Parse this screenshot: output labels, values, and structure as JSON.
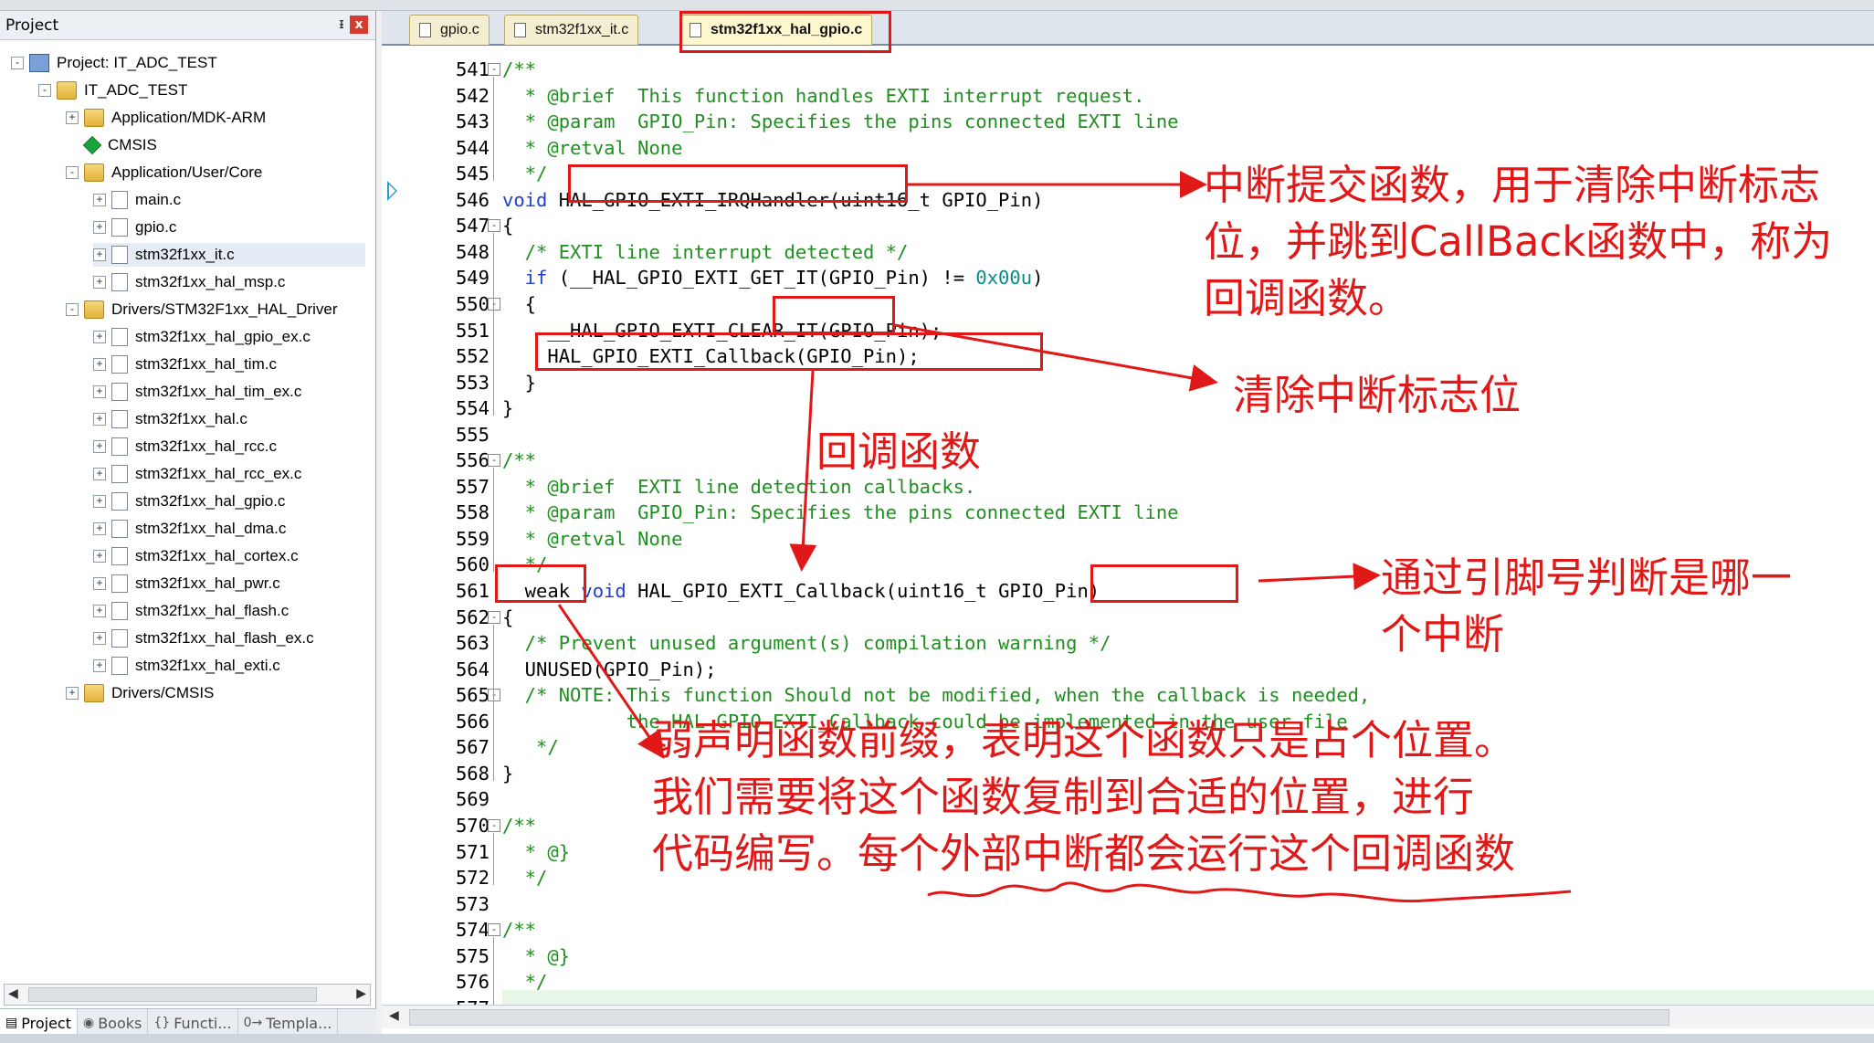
{
  "project_panel": {
    "title": "Project",
    "pin": "ᵻ",
    "close": "x",
    "tree": [
      {
        "label": "Project: IT_ADC_TEST",
        "icon": "project-icon",
        "exp": "-"
      },
      {
        "label": "IT_ADC_TEST",
        "icon": "folder-icon",
        "exp": "-"
      },
      {
        "label": "Application/MDK-ARM",
        "icon": "folder-icon",
        "exp": "+"
      },
      {
        "label": "CMSIS",
        "icon": "cmsis-gem-icon",
        "exp": ""
      },
      {
        "label": "Application/User/Core",
        "icon": "folder-icon",
        "exp": "-"
      },
      {
        "label": "main.c",
        "icon": "file-icon",
        "exp": "+"
      },
      {
        "label": "gpio.c",
        "icon": "file-icon",
        "exp": "+"
      },
      {
        "label": "stm32f1xx_it.c",
        "icon": "file-icon",
        "exp": "+"
      },
      {
        "label": "stm32f1xx_hal_msp.c",
        "icon": "file-icon",
        "exp": "+"
      },
      {
        "label": "Drivers/STM32F1xx_HAL_Driver",
        "icon": "folder-icon",
        "exp": "-"
      },
      {
        "label": "stm32f1xx_hal_gpio_ex.c",
        "icon": "file-icon",
        "exp": "+"
      },
      {
        "label": "stm32f1xx_hal_tim.c",
        "icon": "file-icon",
        "exp": "+"
      },
      {
        "label": "stm32f1xx_hal_tim_ex.c",
        "icon": "file-icon",
        "exp": "+"
      },
      {
        "label": "stm32f1xx_hal.c",
        "icon": "file-icon",
        "exp": "+"
      },
      {
        "label": "stm32f1xx_hal_rcc.c",
        "icon": "file-icon",
        "exp": "+"
      },
      {
        "label": "stm32f1xx_hal_rcc_ex.c",
        "icon": "file-icon",
        "exp": "+"
      },
      {
        "label": "stm32f1xx_hal_gpio.c",
        "icon": "file-icon",
        "exp": "+"
      },
      {
        "label": "stm32f1xx_hal_dma.c",
        "icon": "file-icon",
        "exp": "+"
      },
      {
        "label": "stm32f1xx_hal_cortex.c",
        "icon": "file-icon",
        "exp": "+"
      },
      {
        "label": "stm32f1xx_hal_pwr.c",
        "icon": "file-icon",
        "exp": "+"
      },
      {
        "label": "stm32f1xx_hal_flash.c",
        "icon": "file-icon",
        "exp": "+"
      },
      {
        "label": "stm32f1xx_hal_flash_ex.c",
        "icon": "file-icon",
        "exp": "+"
      },
      {
        "label": "stm32f1xx_hal_exti.c",
        "icon": "file-icon",
        "exp": "+"
      },
      {
        "label": "Drivers/CMSIS",
        "icon": "folder-icon",
        "exp": "+"
      }
    ],
    "bottom_tabs": [
      {
        "label": "Project",
        "icon": "project-tab-icon",
        "glyph": "▤"
      },
      {
        "label": "Books",
        "icon": "books-icon",
        "glyph": "◉"
      },
      {
        "label": "Functi...",
        "icon": "functions-icon",
        "glyph": "{}"
      },
      {
        "label": "Templa...",
        "icon": "templates-icon",
        "glyph": "0→"
      }
    ]
  },
  "editor": {
    "tabs": [
      "gpio.c",
      "stm32f1xx_it.c",
      "stm32f1xx_hal_gpio.c"
    ],
    "active_tab": "stm32f1xx_hal_gpio.c",
    "lines": [
      {
        "n": "541",
        "fold": "-",
        "parts": [
          [
            "cm",
            "/**"
          ]
        ]
      },
      {
        "n": "542",
        "parts": [
          [
            "cm",
            "  * @brief  This function handles EXTI interrupt request."
          ]
        ]
      },
      {
        "n": "543",
        "parts": [
          [
            "cm",
            "  * @param  GPIO_Pin: Specifies the pins connected EXTI line"
          ]
        ]
      },
      {
        "n": "544",
        "parts": [
          [
            "cm",
            "  * @retval None"
          ]
        ]
      },
      {
        "n": "545",
        "parts": [
          [
            "cm",
            "  */"
          ]
        ]
      },
      {
        "n": "546",
        "parts": [
          [
            "kw",
            "void"
          ],
          [
            "",
            " HAL_GPIO_EXTI_IRQHandler(uint16_t GPIO_Pin)"
          ]
        ]
      },
      {
        "n": "547",
        "fold": "-",
        "parts": [
          [
            "",
            "{"
          ]
        ]
      },
      {
        "n": "548",
        "parts": [
          [
            "cm",
            "  /* EXTI line interrupt detected */"
          ]
        ]
      },
      {
        "n": "549",
        "parts": [
          [
            "kw",
            "  if"
          ],
          [
            "",
            " (__HAL_GPIO_EXTI_GET_IT(GPIO_Pin) != "
          ],
          [
            "num",
            "0x00u"
          ],
          [
            "",
            ")"
          ]
        ]
      },
      {
        "n": "550",
        "fold": "-",
        "parts": [
          [
            "",
            "  {"
          ]
        ]
      },
      {
        "n": "551",
        "parts": [
          [
            "",
            "    __HAL_GPIO_EXTI_CLEAR_IT(GPIO_Pin);"
          ]
        ]
      },
      {
        "n": "552",
        "parts": [
          [
            "",
            "    HAL_GPIO_EXTI_Callback(GPIO_Pin);"
          ]
        ]
      },
      {
        "n": "553",
        "parts": [
          [
            "",
            "  }"
          ]
        ]
      },
      {
        "n": "554",
        "parts": [
          [
            "",
            "}"
          ]
        ]
      },
      {
        "n": "555",
        "parts": [
          [
            "",
            ""
          ]
        ]
      },
      {
        "n": "556",
        "fold": "-",
        "parts": [
          [
            "cm",
            "/**"
          ]
        ]
      },
      {
        "n": "557",
        "parts": [
          [
            "cm",
            "  * @brief  EXTI line detection callbacks."
          ]
        ]
      },
      {
        "n": "558",
        "parts": [
          [
            "cm",
            "  * @param  GPIO_Pin: Specifies the pins connected EXTI line"
          ]
        ]
      },
      {
        "n": "559",
        "parts": [
          [
            "cm",
            "  * @retval None"
          ]
        ]
      },
      {
        "n": "560",
        "parts": [
          [
            "cm",
            "  */"
          ]
        ]
      },
      {
        "n": "561",
        "parts": [
          [
            "",
            "__weak "
          ],
          [
            "kw",
            "void"
          ],
          [
            "",
            " HAL_GPIO_EXTI_Callback(uint16_t GPIO_Pin)"
          ]
        ]
      },
      {
        "n": "562",
        "fold": "-",
        "parts": [
          [
            "",
            "{"
          ]
        ]
      },
      {
        "n": "563",
        "parts": [
          [
            "cm",
            "  /* Prevent unused argument(s) compilation warning */"
          ]
        ]
      },
      {
        "n": "564",
        "parts": [
          [
            "",
            "  UNUSED(GPIO_Pin);"
          ]
        ]
      },
      {
        "n": "565",
        "fold": "-",
        "parts": [
          [
            "cm",
            "  /* NOTE: This function Should not be modified, when the callback is needed,"
          ]
        ]
      },
      {
        "n": "566",
        "parts": [
          [
            "cm",
            "           the HAL_GPIO_EXTI_Callback could be implemented in the user file"
          ]
        ]
      },
      {
        "n": "567",
        "parts": [
          [
            "cm",
            "   */"
          ]
        ]
      },
      {
        "n": "568",
        "parts": [
          [
            "",
            "}"
          ]
        ]
      },
      {
        "n": "569",
        "parts": [
          [
            "",
            ""
          ]
        ]
      },
      {
        "n": "570",
        "fold": "-",
        "parts": [
          [
            "cm",
            "/**"
          ]
        ]
      },
      {
        "n": "571",
        "parts": [
          [
            "cm",
            "  * @}"
          ]
        ]
      },
      {
        "n": "572",
        "parts": [
          [
            "cm",
            "  */"
          ]
        ]
      },
      {
        "n": "573",
        "parts": [
          [
            "",
            ""
          ]
        ]
      },
      {
        "n": "574",
        "fold": "-",
        "parts": [
          [
            "cm",
            "/**"
          ]
        ]
      },
      {
        "n": "575",
        "parts": [
          [
            "cm",
            "  * @}"
          ]
        ]
      },
      {
        "n": "576",
        "parts": [
          [
            "cm",
            "  */"
          ]
        ]
      },
      {
        "n": "577",
        "parts": [
          [
            "",
            ""
          ]
        ]
      }
    ]
  },
  "annotations": {
    "irq_handler_note": [
      "中断提交函数，用于清除中断标志",
      "位，并跳到CallBack函数中，称为",
      "回调函数。"
    ],
    "clear_flag_note": "清除中断标志位",
    "callback_note": "回调函数",
    "gpio_pin_note": [
      "通过引脚号判断是哪一",
      "个中断"
    ],
    "weak_note": [
      "弱声明函数前缀，表明这个函数只是占个位置。",
      "我们需要将这个函数复制到合适的位置，进行",
      "代码编写。每个外部中断都会运行这个回调函数"
    ],
    "color": "#e01818"
  }
}
